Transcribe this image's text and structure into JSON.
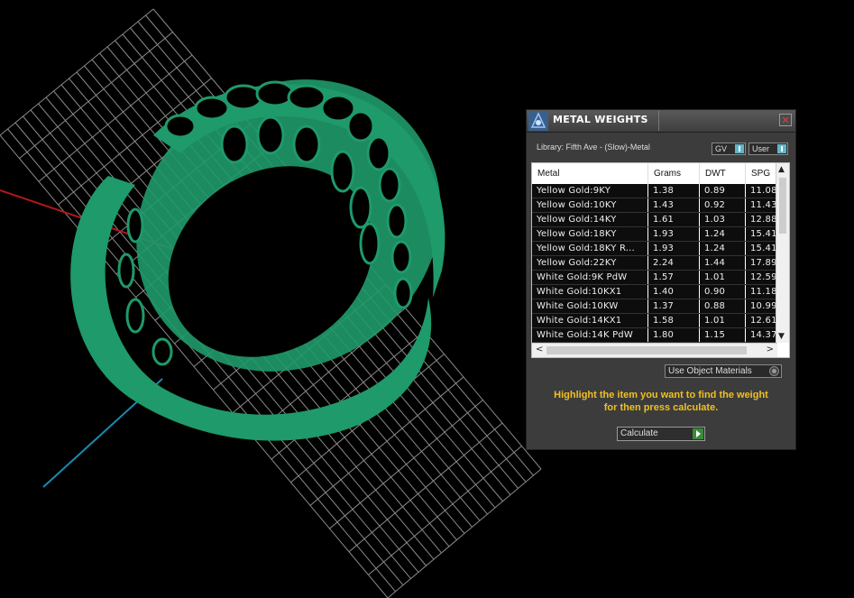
{
  "viewport": {
    "grid_color": "#8a8a8a",
    "x_axis_color": "#b01818",
    "z_axis_color": "#1a8ab0",
    "model_color": "#1f9a6a"
  },
  "panel": {
    "title": "METAL WEIGHTS",
    "close_symbol": "✕",
    "library_label": "Library: Fifth Ave - (Slow)-Metal",
    "gv_label": "GV",
    "user_label": "User",
    "use_object_materials_label": "Use Object Materials",
    "hint_line1": "Highlight the item you want to find the weight",
    "hint_line2": "for then press calculate.",
    "calculate_label": "Calculate",
    "scroll_up_icon": "▲",
    "scroll_down_icon": "▼",
    "scroll_left_icon": "<",
    "scroll_right_icon": ">",
    "accent_color": "#f0c020"
  },
  "table": {
    "columns": [
      "Metal",
      "Grams",
      "DWT",
      "SPG"
    ],
    "rows": [
      [
        "Yellow Gold:9KY",
        "1.38",
        "0.89",
        "11.08"
      ],
      [
        "Yellow Gold:10KY",
        "1.43",
        "0.92",
        "11.43"
      ],
      [
        "Yellow Gold:14KY",
        "1.61",
        "1.03",
        "12.88"
      ],
      [
        "Yellow Gold:18KY",
        "1.93",
        "1.24",
        "15.41"
      ],
      [
        "Yellow Gold:18KY R...",
        "1.93",
        "1.24",
        "15.41"
      ],
      [
        "Yellow Gold:22KY",
        "2.24",
        "1.44",
        "17.89"
      ],
      [
        "White Gold:9K PdW",
        "1.57",
        "1.01",
        "12.59"
      ],
      [
        "White Gold:10KX1",
        "1.40",
        "0.90",
        "11.18"
      ],
      [
        "White Gold:10KW",
        "1.37",
        "0.88",
        "10.99"
      ],
      [
        "White Gold:14KX1",
        "1.58",
        "1.01",
        "12.61"
      ],
      [
        "White Gold:14K PdW",
        "1.80",
        "1.15",
        "14.37"
      ]
    ]
  }
}
